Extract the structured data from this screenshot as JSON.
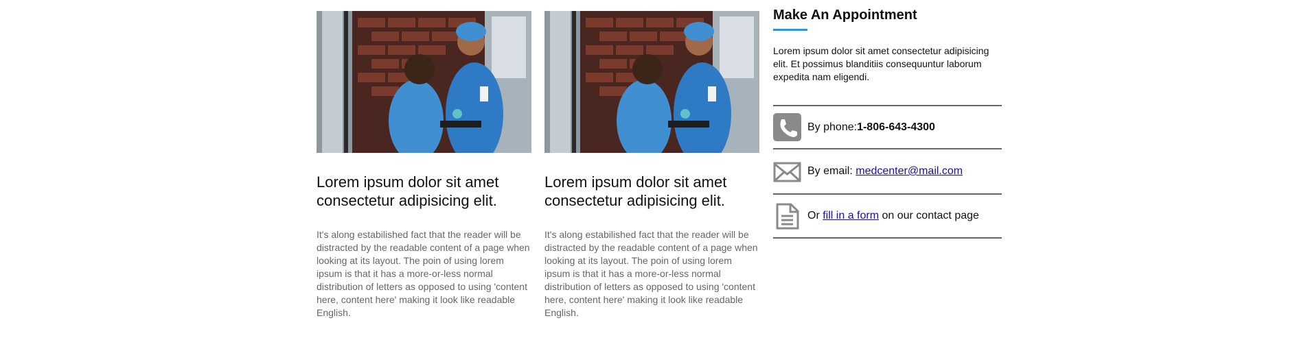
{
  "cards": [
    {
      "image": "doctor-and-patient-photo",
      "title": "Lorem ipsum dolor sit amet consectetur adipisicing elit.",
      "body": "It's along estabilished fact that the reader will be distracted by the readable content of a page when looking at its layout. The poin of using lorem ipsum is that it has a more-or-less normal distribution of letters as opposed to using 'content here, content here' making it look like readable English."
    },
    {
      "image": "doctor-and-patient-photo",
      "title": "Lorem ipsum dolor sit amet consectetur adipisicing elit.",
      "body": "It's along estabilished fact that the reader will be distracted by the readable content of a page when looking at its layout. The poin of using lorem ipsum is that it has a more-or-less normal distribution of letters as opposed to using 'content here, content here' making it look like readable English."
    }
  ],
  "appointment": {
    "title": "Make An Appointment",
    "accent_color": "#1aa0e0",
    "intro": "Lorem ipsum dolor sit amet consectetur adipisicing elit. Et possimus blanditiis consequuntur laborum expedita nam eligendi.",
    "phone": {
      "icon": "phone-icon",
      "label": "By phone: ",
      "number": "1-806-643-4300"
    },
    "email": {
      "icon": "envelope-icon",
      "label": "By email: ",
      "address": "medcenter@mail.com"
    },
    "form": {
      "icon": "document-icon",
      "prefix": "Or ",
      "link": "fill in a form",
      "suffix": " on our contact page"
    }
  }
}
